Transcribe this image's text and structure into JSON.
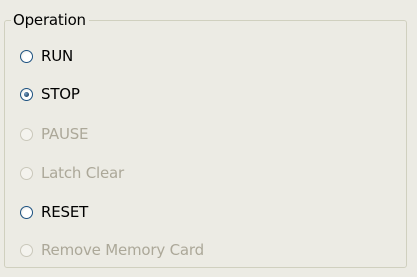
{
  "groupbox": {
    "title": "Operation"
  },
  "options": [
    {
      "label": "RUN",
      "checked": false,
      "enabled": true
    },
    {
      "label": "STOP",
      "checked": true,
      "enabled": true
    },
    {
      "label": "PAUSE",
      "checked": false,
      "enabled": false
    },
    {
      "label": "Latch Clear",
      "checked": false,
      "enabled": false
    },
    {
      "label": "RESET",
      "checked": false,
      "enabled": true
    },
    {
      "label": "Remove Memory Card",
      "checked": false,
      "enabled": false
    }
  ],
  "colors": {
    "background": "#ecebe4",
    "border": "#d0d0bf",
    "disabled_text": "#aca899",
    "radio_border": "#1c5180"
  }
}
